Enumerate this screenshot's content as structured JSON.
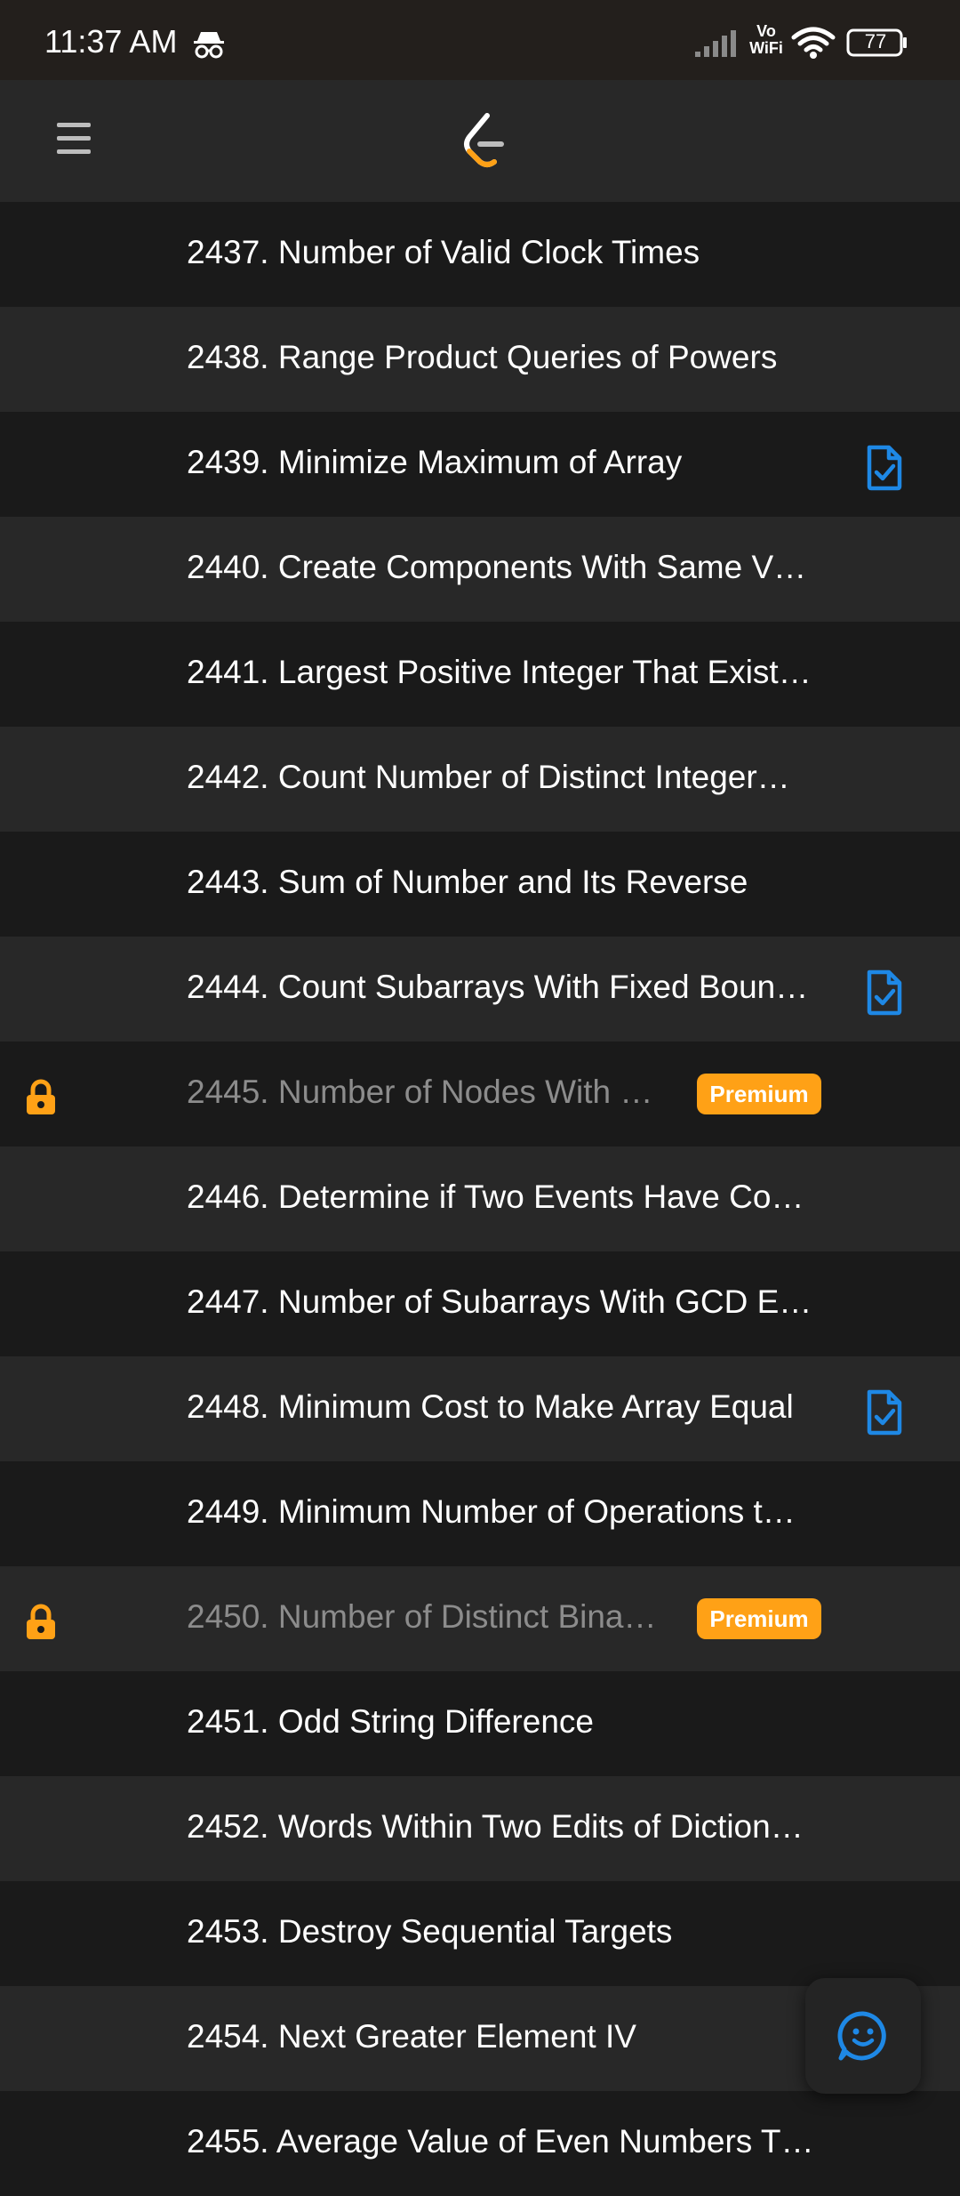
{
  "status_bar": {
    "time": "11:37 AM",
    "vowifi_line1": "Vo",
    "vowifi_line2": "WiFi",
    "battery": "77"
  },
  "colors": {
    "accent": "#ffa116",
    "solution_icon": "#1e88e5",
    "row_dark": "#1a1a1a",
    "row_light": "#282828"
  },
  "problems": [
    {
      "title": "2437. Number of Valid Clock Times",
      "locked": false,
      "premium": "",
      "solution": false
    },
    {
      "title": "2438. Range Product Queries of Powers",
      "locked": false,
      "premium": "",
      "solution": false
    },
    {
      "title": "2439. Minimize Maximum of Array",
      "locked": false,
      "premium": "",
      "solution": true
    },
    {
      "title": "2440. Create Components With Same V…",
      "locked": false,
      "premium": "",
      "solution": false
    },
    {
      "title": "2441. Largest Positive Integer That Exist…",
      "locked": false,
      "premium": "",
      "solution": false
    },
    {
      "title": "2442. Count Number of Distinct Integer…",
      "locked": false,
      "premium": "",
      "solution": false
    },
    {
      "title": "2443. Sum of Number and Its Reverse",
      "locked": false,
      "premium": "",
      "solution": false
    },
    {
      "title": "2444. Count Subarrays With Fixed Boun…",
      "locked": false,
      "premium": "",
      "solution": true
    },
    {
      "title": "2445. Number of Nodes With …",
      "locked": true,
      "premium": "Premium",
      "solution": false
    },
    {
      "title": "2446. Determine if Two Events Have Co…",
      "locked": false,
      "premium": "",
      "solution": false
    },
    {
      "title": "2447. Number of Subarrays With GCD E…",
      "locked": false,
      "premium": "",
      "solution": false
    },
    {
      "title": "2448. Minimum Cost to Make Array Equal",
      "locked": false,
      "premium": "",
      "solution": true
    },
    {
      "title": "2449. Minimum Number of Operations t…",
      "locked": false,
      "premium": "",
      "solution": false
    },
    {
      "title": "2450. Number of Distinct Bina…",
      "locked": true,
      "premium": "Premium",
      "solution": false
    },
    {
      "title": "2451. Odd String Difference",
      "locked": false,
      "premium": "",
      "solution": false
    },
    {
      "title": "2452. Words Within Two Edits of Diction…",
      "locked": false,
      "premium": "",
      "solution": false
    },
    {
      "title": "2453. Destroy Sequential Targets",
      "locked": false,
      "premium": "",
      "solution": false
    },
    {
      "title": "2454. Next Greater Element IV",
      "locked": false,
      "premium": "",
      "solution": false
    },
    {
      "title": "2455. Average Value of Even Numbers T…",
      "locked": false,
      "premium": "",
      "solution": false
    }
  ]
}
